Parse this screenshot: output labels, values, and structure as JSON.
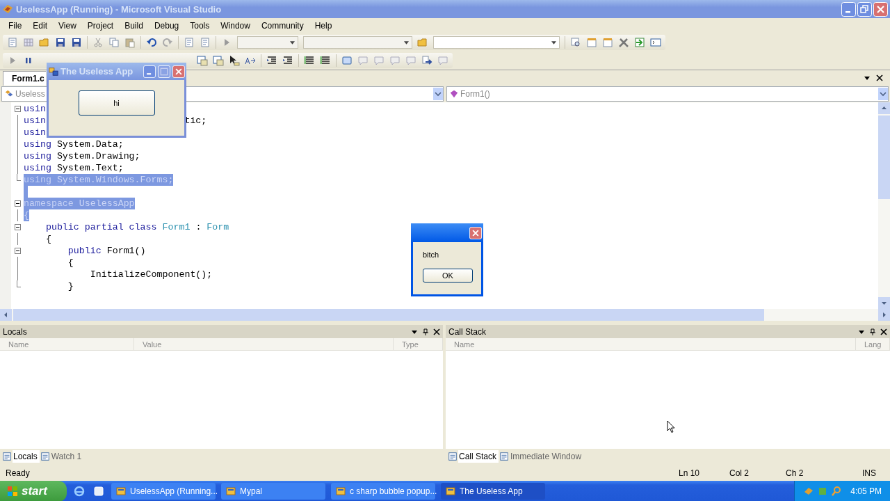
{
  "window": {
    "title": "UselessApp (Running) - Microsoft Visual Studio"
  },
  "menu": [
    "File",
    "Edit",
    "View",
    "Project",
    "Build",
    "Debug",
    "Tools",
    "Window",
    "Community",
    "Help"
  ],
  "document_tabs": [
    {
      "label": "Form1.c",
      "selected": true
    }
  ],
  "nav_bar": {
    "type_dropdown": "Useless",
    "member_dropdown": "Form1()"
  },
  "code_lines": [
    {
      "kind": "fold_start",
      "selected": false,
      "tokens": [
        {
          "t": "usin",
          "kind": "kw"
        }
      ]
    },
    {
      "kind": "fold_mid",
      "selected": false,
      "tokens": [
        {
          "t": "usin",
          "kind": "kw"
        }
      ],
      "tail": "tic;"
    },
    {
      "kind": "fold_mid",
      "selected": false,
      "tokens": [
        {
          "t": "usin",
          "kind": "kw"
        }
      ]
    },
    {
      "kind": "fold_mid",
      "selected": false,
      "tokens": [
        {
          "t": "using",
          "kind": "kw"
        },
        {
          "t": " System.Data;",
          "kind": "plain"
        }
      ]
    },
    {
      "kind": "fold_mid",
      "selected": false,
      "tokens": [
        {
          "t": "using",
          "kind": "kw"
        },
        {
          "t": " System.Drawing;",
          "kind": "plain"
        }
      ]
    },
    {
      "kind": "fold_mid",
      "selected": false,
      "tokens": [
        {
          "t": "using",
          "kind": "kw"
        },
        {
          "t": " System.Text;",
          "kind": "plain"
        }
      ]
    },
    {
      "kind": "fold_end",
      "selected": true,
      "tokens": [
        {
          "t": "using",
          "kind": "kw"
        },
        {
          "t": " System.Windows.Forms;",
          "kind": "plain"
        }
      ]
    },
    {
      "kind": "blank",
      "selected": true
    },
    {
      "kind": "fold_start",
      "selected": true,
      "tokens": [
        {
          "t": "namespace",
          "kind": "kw"
        },
        {
          "t": " UselessApp",
          "kind": "plain"
        }
      ]
    },
    {
      "kind": "fold_mid",
      "selected": true,
      "tokens": [
        {
          "t": "{",
          "kind": "plain"
        }
      ]
    },
    {
      "kind": "fold_start",
      "selected": false,
      "tokens": [
        {
          "t": "    public partial class",
          "kind": "kw"
        },
        {
          "t": " Form1",
          "kind": "type"
        },
        {
          "t": " : ",
          "kind": "plain"
        },
        {
          "t": "Form",
          "kind": "type"
        }
      ]
    },
    {
      "kind": "fold_mid",
      "selected": false,
      "tokens": [
        {
          "t": "    {",
          "kind": "plain"
        }
      ]
    },
    {
      "kind": "fold_start",
      "selected": false,
      "tokens": [
        {
          "t": "        public",
          "kind": "kw"
        },
        {
          "t": " Form1()",
          "kind": "plain"
        }
      ]
    },
    {
      "kind": "fold_mid",
      "selected": false,
      "tokens": [
        {
          "t": "        {",
          "kind": "plain"
        }
      ]
    },
    {
      "kind": "fold_mid",
      "selected": false,
      "tokens": [
        {
          "t": "            InitializeComponent();",
          "kind": "plain"
        }
      ]
    },
    {
      "kind": "fold_end",
      "selected": false,
      "tokens": [
        {
          "t": "        }",
          "kind": "plain"
        }
      ]
    }
  ],
  "running_app": {
    "title": "The Useless App",
    "button": "hi"
  },
  "message_box": {
    "text": "bitch",
    "button": "OK"
  },
  "locals_panel": {
    "title": "Locals",
    "columns": [
      "Name",
      "Value",
      "Type"
    ],
    "tabs": [
      {
        "label": "Locals",
        "selected": true
      },
      {
        "label": "Watch 1",
        "selected": false
      }
    ]
  },
  "call_stack_panel": {
    "title": "Call Stack",
    "columns": [
      "Name",
      "Lang"
    ],
    "tabs": [
      {
        "label": "Call Stack",
        "selected": true
      },
      {
        "label": "Immediate Window",
        "selected": false
      }
    ]
  },
  "status_bar": {
    "text": "Ready",
    "line": "Ln 10",
    "column": "Col 2",
    "char": "Ch 2",
    "mode": "INS"
  },
  "taskbar": {
    "start": "start",
    "buttons": [
      {
        "label": "UselessApp (Running...",
        "selected": false
      },
      {
        "label": "Mypal",
        "selected": false
      },
      {
        "label": "c sharp bubble popup...",
        "selected": false
      },
      {
        "label": "The Useless App",
        "selected": true
      }
    ],
    "clock": "4:05 PM"
  }
}
